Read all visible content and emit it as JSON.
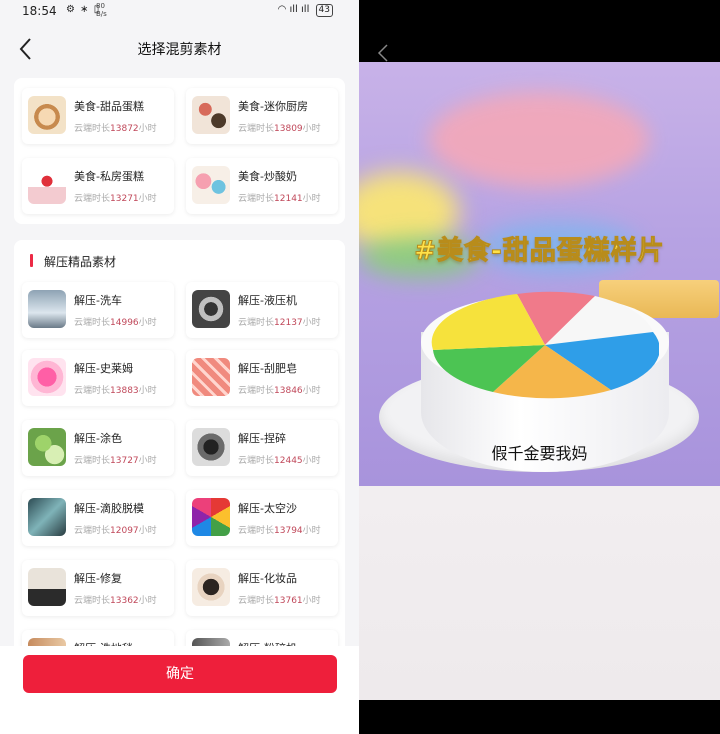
{
  "status_bar": {
    "time": "18:54",
    "net_speed_top": "80",
    "net_speed_bottom": "B/s",
    "battery": "43"
  },
  "header": {
    "title": "选择混剪素材"
  },
  "food_section": {
    "items": [
      {
        "name": "美食-甜品蛋糕",
        "dur_prefix": "云端时长",
        "dur_value": "13872",
        "dur_unit": "小时",
        "thumb": "dessert-cake"
      },
      {
        "name": "美食-迷你厨房",
        "dur_prefix": "云端时长",
        "dur_value": "13809",
        "dur_unit": "小时",
        "thumb": "mini-kitchen"
      },
      {
        "name": "美食-私房蛋糕",
        "dur_prefix": "云端时长",
        "dur_value": "13271",
        "dur_unit": "小时",
        "thumb": "private-cake"
      },
      {
        "name": "美食-炒酸奶",
        "dur_prefix": "云端时长",
        "dur_value": "12141",
        "dur_unit": "小时",
        "thumb": "fried-yogurt"
      }
    ]
  },
  "relax_section": {
    "title": "解压精品素材",
    "items": [
      {
        "name": "解压-洗车",
        "dur_prefix": "云端时长",
        "dur_value": "14996",
        "dur_unit": "小时",
        "thumb": "car-wash"
      },
      {
        "name": "解压-液压机",
        "dur_prefix": "云端时长",
        "dur_value": "12137",
        "dur_unit": "小时",
        "thumb": "hydraulic-press"
      },
      {
        "name": "解压-史莱姆",
        "dur_prefix": "云端时长",
        "dur_value": "13883",
        "dur_unit": "小时",
        "thumb": "slime"
      },
      {
        "name": "解压-刮肥皂",
        "dur_prefix": "云端时长",
        "dur_value": "13846",
        "dur_unit": "小时",
        "thumb": "soap-cutting"
      },
      {
        "name": "解压-涂色",
        "dur_prefix": "云端时长",
        "dur_value": "13727",
        "dur_unit": "小时",
        "thumb": "painting"
      },
      {
        "name": "解压-捏碎",
        "dur_prefix": "云端时长",
        "dur_value": "12445",
        "dur_unit": "小时",
        "thumb": "crushing"
      },
      {
        "name": "解压-滴胶脱模",
        "dur_prefix": "云端时长",
        "dur_value": "12097",
        "dur_unit": "小时",
        "thumb": "resin-mold"
      },
      {
        "name": "解压-太空沙",
        "dur_prefix": "云端时长",
        "dur_value": "13794",
        "dur_unit": "小时",
        "thumb": "space-sand"
      },
      {
        "name": "解压-修复",
        "dur_prefix": "云端时长",
        "dur_value": "13362",
        "dur_unit": "小时",
        "thumb": "repair"
      },
      {
        "name": "解压-化妆品",
        "dur_prefix": "云端时长",
        "dur_value": "13761",
        "dur_unit": "小时",
        "thumb": "cosmetics"
      },
      {
        "name": "解压-洗地毯",
        "thumb": "rug-wash"
      },
      {
        "name": "解压-粉碎机",
        "thumb": "shredder"
      }
    ]
  },
  "footer": {
    "confirm_label": "确定"
  },
  "preview": {
    "overlay_title": "#美食-甜品蛋糕样片",
    "subtitle": "假千金要我妈"
  },
  "colors": {
    "accent": "#ee1f3b",
    "duration_number": "#c0485a",
    "overlay_title": "#ffe24a"
  }
}
